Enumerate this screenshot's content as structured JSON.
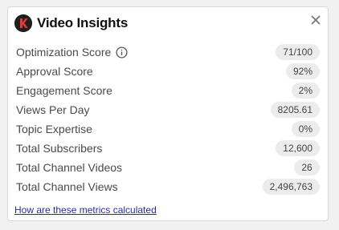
{
  "panel": {
    "title": "Video Insights",
    "logo_letter": "K",
    "link_text": "How are these metrics calculated"
  },
  "metrics": [
    {
      "label": "Optimization Score",
      "value": "71/100"
    },
    {
      "label": "Approval Score",
      "value": "92%"
    },
    {
      "label": "Engagement Score",
      "value": "2%"
    },
    {
      "label": "Views Per Day",
      "value": "8205.61"
    },
    {
      "label": "Topic Expertise",
      "value": "0%"
    },
    {
      "label": "Total Subscribers",
      "value": "12,600"
    },
    {
      "label": "Total Channel Videos",
      "value": "26"
    },
    {
      "label": "Total Channel Views",
      "value": "2,496,763"
    }
  ],
  "icons": {
    "logo": "brand-logo-icon",
    "info": "info-circle-icon",
    "close": "close-icon"
  },
  "colors": {
    "logo_bg": "#1f1f1f",
    "logo_accent": "#e53935",
    "pill_bg": "#ececec",
    "link": "#2b2b9a"
  }
}
